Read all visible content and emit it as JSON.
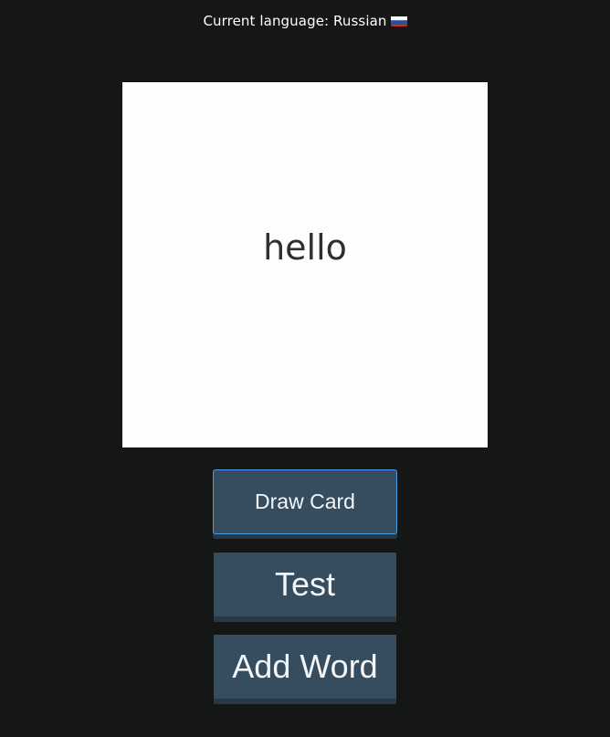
{
  "language": {
    "label": "Current language: Russian",
    "flag_icon": "russia-flag-icon"
  },
  "card": {
    "word": "hello"
  },
  "buttons": {
    "draw_card": "Draw Card",
    "test": "Test",
    "add_word": "Add Word"
  },
  "colors": {
    "background": "#151717",
    "card_background": "#fffdfd",
    "button_background": "#364c5f",
    "focus_outline": "#4a9be8",
    "flag_white": "#ffffff",
    "flag_blue": "#1c57a7",
    "flag_red": "#d52b1e"
  }
}
